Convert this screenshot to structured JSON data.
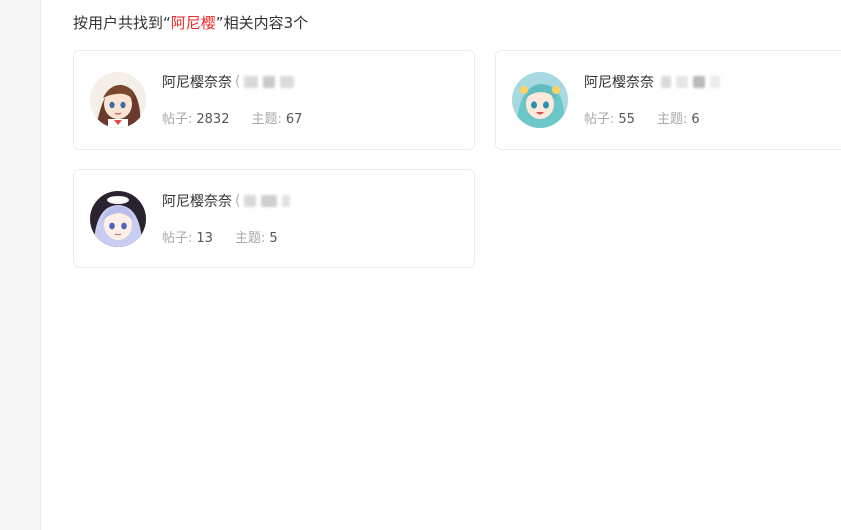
{
  "search": {
    "prefix": "按用户共找到“",
    "keyword": "阿尼樱",
    "suffix": "”相关内容3个"
  },
  "users": [
    {
      "name": "阿尼樱奈奈",
      "id_open": "(",
      "posts_label": "帖子:",
      "posts": "2832",
      "topics_label": "主题:",
      "topics": "67"
    },
    {
      "name": "阿尼樱奈奈",
      "id_open": "",
      "posts_label": "帖子:",
      "posts": "55",
      "topics_label": "主题:",
      "topics": "6"
    },
    {
      "name": "阿尼樱奈奈",
      "id_open": "(",
      "posts_label": "帖子:",
      "posts": "13",
      "topics_label": "主题:",
      "topics": "5"
    }
  ],
  "colors": {
    "keyword": "#ec2a2a",
    "text": "#333333",
    "muted": "#a8a8ad"
  }
}
